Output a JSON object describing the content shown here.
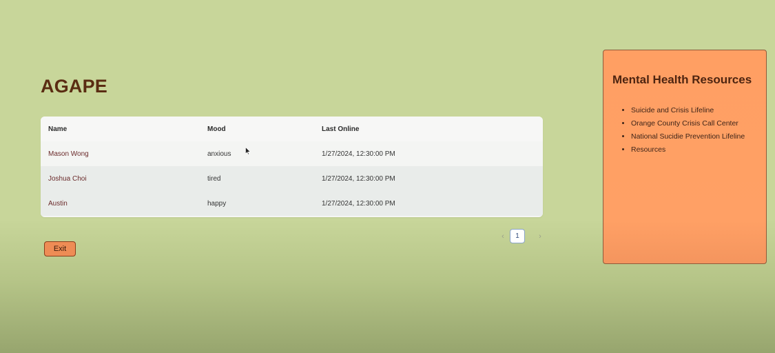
{
  "app": {
    "title": "AGAPE"
  },
  "table": {
    "columns": [
      "Name",
      "Mood",
      "Last Online"
    ],
    "rows": [
      {
        "name": "Mason Wong",
        "mood": "anxious",
        "last_online": "1/27/2024, 12:30:00 PM"
      },
      {
        "name": "Joshua Choi",
        "mood": "tired",
        "last_online": "1/27/2024, 12:30:00 PM"
      },
      {
        "name": "Austin",
        "mood": "happy",
        "last_online": "1/27/2024, 12:30:00 PM"
      }
    ]
  },
  "pagination": {
    "prev_icon": "‹",
    "current_page": "1",
    "next_icon": "›"
  },
  "exit_button": {
    "label": "Exit"
  },
  "resources": {
    "title": "Mental Health Resources",
    "items": [
      "Suicide and Crisis Lifeline",
      "Orange County Crisis Call Center",
      "National Sucidie Prevention Lifeline",
      "Resources"
    ]
  },
  "colors": {
    "background": "#c8d69a",
    "title": "#5a2c12",
    "panel": "#ffa065",
    "exit_button": "#ee8c55"
  },
  "icons": {
    "cursor": "mouse-pointer-icon"
  }
}
